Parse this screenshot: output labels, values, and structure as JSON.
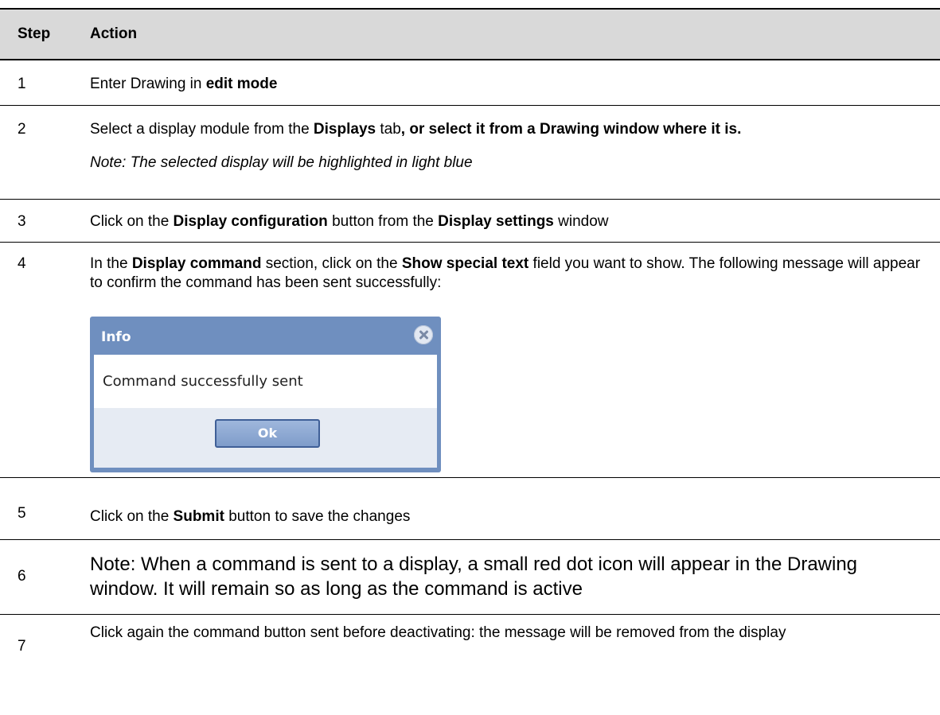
{
  "header": {
    "step": "Step",
    "action": "Action"
  },
  "rows": [
    {
      "num": "1",
      "parts": [
        "Enter Drawing in ",
        "edit mode"
      ]
    },
    {
      "num": "2",
      "parts": [
        "Select a display module from the ",
        "Displays",
        " tab",
        ", or select it from a Drawing window where it is."
      ],
      "note": "Note: The selected display will be highlighted in light blue"
    },
    {
      "num": "3",
      "parts": [
        "Click on the ",
        "Display configuration",
        " button from the ",
        "Display settings",
        " window"
      ]
    },
    {
      "num": "4",
      "parts": [
        "In the ",
        "Display command",
        " section, click on the ",
        "Show special text",
        " field you want to show. The following message will appear to confirm the command has been sent successfully:"
      ],
      "dialog": {
        "title": "Info",
        "message": "Command successfully sent",
        "ok_label": "Ok",
        "close_icon": "close-circle-icon"
      }
    },
    {
      "num": "5",
      "parts": [
        "Click on the ",
        "Submit",
        " button to save the changes"
      ]
    },
    {
      "num": "6",
      "text": "Note: When a command is sent to a display, a small red dot icon will appear in the Drawing window. It will remain so as long as the command is active"
    },
    {
      "num": "7",
      "text": "Click again the command button sent before deactivating: the message will be removed from the display"
    }
  ],
  "colors": {
    "header_bg": "#d9d9d9",
    "dialog_frame": "#6f8fbf",
    "dialog_footer": "#e6ebf3",
    "ok_button": "#7f9cca"
  }
}
